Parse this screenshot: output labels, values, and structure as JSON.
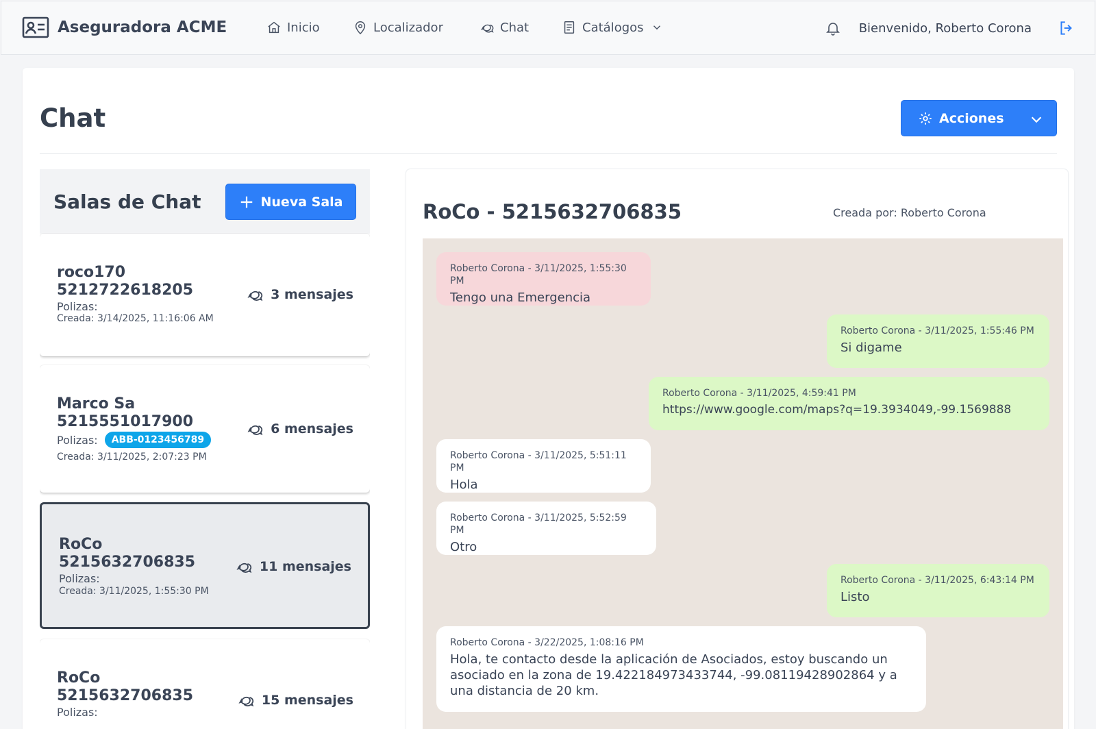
{
  "brand": {
    "name": "Aseguradora ACME"
  },
  "nav": {
    "inicio": "Inicio",
    "localizador": "Localizador",
    "chat": "Chat",
    "catalogos": "Catálogos"
  },
  "user": {
    "welcome": "Bienvenido, Roberto Corona"
  },
  "page": {
    "title": "Chat",
    "actions_label": "Acciones"
  },
  "rooms": {
    "title": "Salas de Chat",
    "new_room_label": "Nueva Sala",
    "polizas_label": "Polizas:",
    "items": [
      {
        "name": "roco170",
        "phone": "5212722618205",
        "poliza": "",
        "created": "Creada: 3/14/2025, 11:16:06 AM",
        "count": "3 mensajes",
        "active": false
      },
      {
        "name": "Marco Sa",
        "phone": "5215551017900",
        "poliza": "ABB-0123456789",
        "created": "Creada: 3/11/2025, 2:07:23 PM",
        "count": "6 mensajes",
        "active": false
      },
      {
        "name": "RoCo",
        "phone": "5215632706835",
        "poliza": "",
        "created": "Creada: 3/11/2025, 1:55:30 PM",
        "count": "11 mensajes",
        "active": true
      },
      {
        "name": "RoCo",
        "phone": "5215632706835",
        "poliza": "",
        "created": "",
        "count": "15 mensajes",
        "active": false
      }
    ]
  },
  "chat": {
    "title": "RoCo - 5215632706835",
    "creator": "Creada por: Roberto Corona",
    "messages": [
      {
        "meta": "Roberto Corona - 3/11/2025, 1:55:30 PM",
        "text": "Tengo una Emergencia",
        "kind": "alert"
      },
      {
        "meta": "Roberto Corona - 3/11/2025, 1:55:46 PM",
        "text": "Si digame",
        "kind": "sent"
      },
      {
        "meta": "Roberto Corona - 3/11/2025, 4:59:41 PM",
        "text": "https://www.google.com/maps?q=19.3934049,-99.1569888",
        "kind": "sent"
      },
      {
        "meta": "Roberto Corona - 3/11/2025, 5:51:11 PM",
        "text": "Hola",
        "kind": "recv"
      },
      {
        "meta": "Roberto Corona - 3/11/2025, 5:52:59 PM",
        "text": "Otro",
        "kind": "recv"
      },
      {
        "meta": "Roberto Corona - 3/11/2025, 6:43:14 PM",
        "text": "Listo",
        "kind": "sent"
      },
      {
        "meta": "Roberto Corona - 3/22/2025, 1:08:16 PM",
        "text": "Hola, te contacto desde la aplicación de Asociados, estoy buscando un asociado en la zona de 19.422184973433744, -99.08119428902864 y a una distancia de 20 km.",
        "kind": "recv"
      }
    ]
  },
  "colors": {
    "primary": "#2d7ff9",
    "badge": "#0ea5e9",
    "sent_bubble": "#dcf8c6",
    "alert_bubble": "#f7d7da",
    "chat_bg": "#ebe4de"
  },
  "icons": {
    "brand": "id-card-icon",
    "inicio": "home-icon",
    "localizador": "map-pin-icon",
    "chat": "chat-bubbles-icon",
    "catalogos": "document-icon",
    "bell": "bell-icon",
    "logout": "logout-icon",
    "actions": "gear-icon",
    "new_room": "plus-icon"
  }
}
